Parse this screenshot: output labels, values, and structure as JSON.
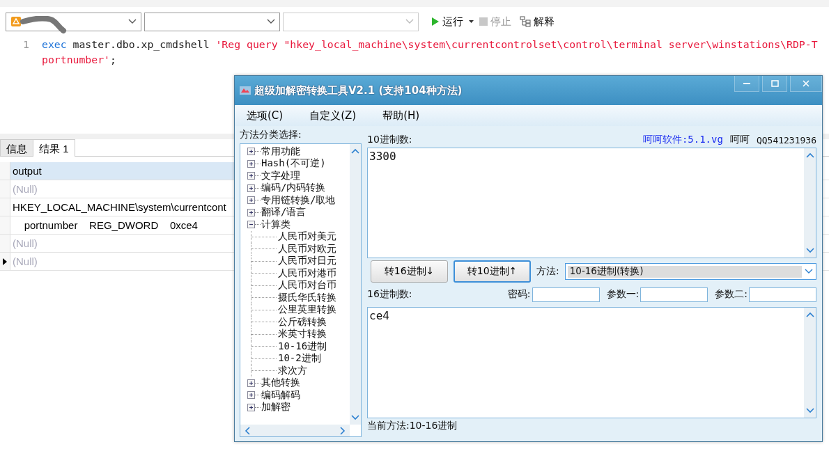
{
  "toolbar": {
    "combos": [
      {
        "disabled": false
      },
      {
        "disabled": false
      },
      {
        "disabled": true
      }
    ],
    "buttons": [
      {
        "label": "运行",
        "kind": "run",
        "disabled": false
      },
      {
        "label": "停止",
        "kind": "stop",
        "disabled": true
      },
      {
        "label": "解释",
        "kind": "explain",
        "disabled": false
      }
    ]
  },
  "editor": {
    "lines": [
      {
        "number": "1",
        "parts": [
          {
            "text": "exec",
            "kind": "keyword"
          },
          {
            "text": " master.dbo.xp_cmdshell ",
            "kind": "plain"
          },
          {
            "text": "'Reg query \"hkey_local_machine\\system\\currentcontrolset\\control\\terminal server\\winstations\\RDP-T",
            "kind": "string"
          }
        ]
      },
      {
        "parts": [
          {
            "text": "portnumber'",
            "kind": "string"
          },
          {
            "text": ";",
            "kind": "plain"
          }
        ]
      }
    ]
  },
  "result_tabs": [
    {
      "label": "信息",
      "selected": false
    },
    {
      "label": "结果 1",
      "selected": true
    }
  ],
  "grid": {
    "column": "output",
    "rows": [
      {
        "value": "(Null)",
        "is_null": true,
        "current": false
      },
      {
        "value": "HKEY_LOCAL_MACHINE\\system\\currentcont",
        "is_null": false,
        "current": false
      },
      {
        "value": "    portnumber    REG_DWORD    0xce4",
        "is_null": false,
        "current": false
      },
      {
        "value": "(Null)",
        "is_null": true,
        "current": false
      },
      {
        "value": "(Null)",
        "is_null": true,
        "current": true
      }
    ]
  },
  "tool_window": {
    "title": "超级加解密转换工具V2.1 (支持104种方法)",
    "menu": [
      "选项(C)",
      "自定义(Z)",
      "帮助(H)"
    ],
    "tree_label": "方法分类选择:",
    "tree": [
      {
        "label": "常用功能",
        "expanded": false
      },
      {
        "label": "Hash(不可逆)",
        "expanded": false
      },
      {
        "label": "文字处理",
        "expanded": false
      },
      {
        "label": "编码/内码转换",
        "expanded": false
      },
      {
        "label": "专用链转换/取地",
        "expanded": false
      },
      {
        "label": "翻译/语言",
        "expanded": false
      },
      {
        "label": "计算类",
        "expanded": true,
        "children": [
          {
            "label": "人民币对美元"
          },
          {
            "label": "人民币对欧元"
          },
          {
            "label": "人民币对日元"
          },
          {
            "label": "人民币对港币"
          },
          {
            "label": "人民币对台币"
          },
          {
            "label": "摄氏华氏转换"
          },
          {
            "label": "公里英里转换"
          },
          {
            "label": "公斤磅转换"
          },
          {
            "label": "米英寸转换"
          },
          {
            "label": "10-16进制"
          },
          {
            "label": "10-2进制"
          },
          {
            "label": "求次方"
          }
        ]
      },
      {
        "label": "其他转换",
        "expanded": false
      },
      {
        "label": "编码解码",
        "expanded": false
      },
      {
        "label": "加解密",
        "expanded": false
      }
    ],
    "decimal_label": "10进制数:",
    "link": "呵呵软件:5.1.vg",
    "author": "呵呵",
    "qq": "QQ541231936",
    "decimal_value": "3300",
    "buttons": [
      {
        "label": "转16进制↓",
        "focused": false
      },
      {
        "label": "转10进制↑",
        "focused": true
      }
    ],
    "method_label": "方法:",
    "method_value": "10-16进制(转换)",
    "hex_label": "16进制数:",
    "params": [
      {
        "label": "密码:"
      },
      {
        "label": "参数一:"
      },
      {
        "label": "参数二:"
      }
    ],
    "hex_value": "ce4",
    "status": "当前方法:10-16进制"
  }
}
